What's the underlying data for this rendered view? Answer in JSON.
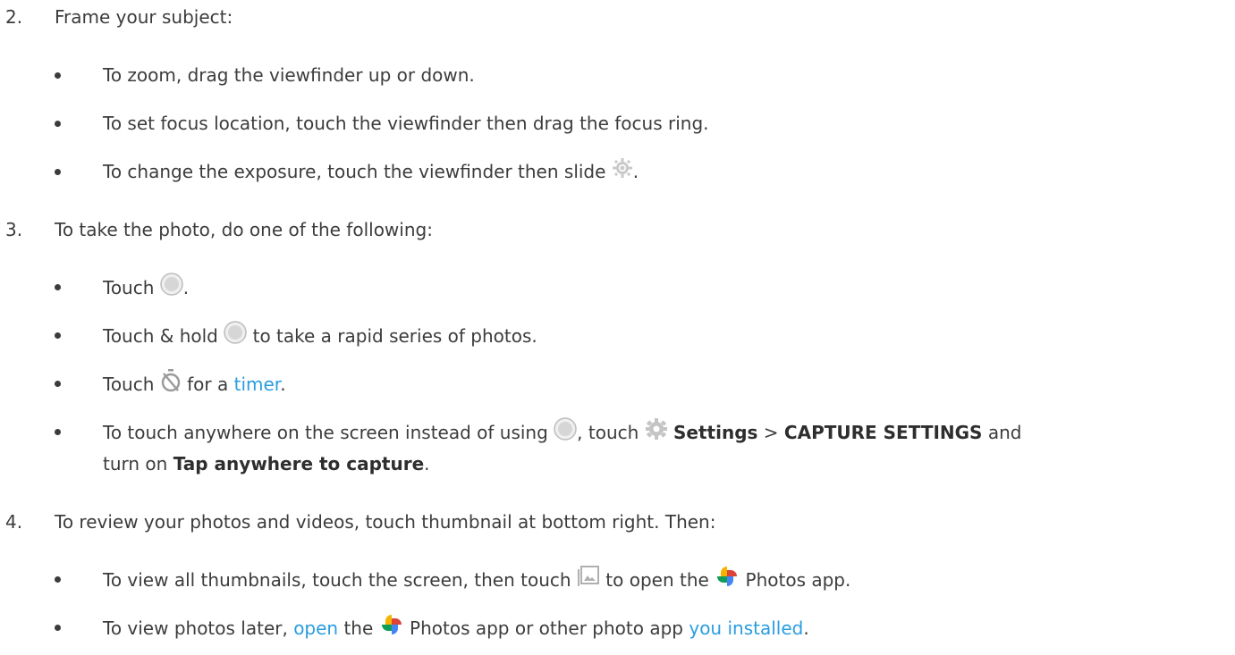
{
  "steps": [
    {
      "num": "2.",
      "text": "Frame your subject:",
      "bullets": [
        {
          "text": "To zoom, drag the viewfinder up or down."
        },
        {
          "text": "To set focus location, touch the viewfinder then drag the focus ring."
        },
        {
          "before": "To change the exposure, touch the viewfinder then slide",
          "after": "."
        }
      ]
    },
    {
      "num": "3.",
      "text": "To take the photo, do one of the following:",
      "bullets": [
        {
          "before": "Touch",
          "after": "."
        },
        {
          "before": "Touch & hold",
          "after": "to take a rapid series of photos."
        },
        {
          "before": "Touch",
          "mid": "for a",
          "link": "timer",
          "after": "."
        },
        {
          "before": "To touch anywhere on the screen instead of using",
          "mid": ", touch",
          "bold1": "Settings",
          "sep": " > ",
          "bold2": "CAPTURE SETTINGS",
          "tail": " and",
          "line2_pre": "turn on ",
          "bold3": "Tap anywhere to capture",
          "line2_post": "."
        }
      ]
    },
    {
      "num": "4.",
      "text": "To review your photos and videos, touch thumbnail at bottom right. Then:",
      "bullets": [
        {
          "before": "To view all thumbnails, touch the screen, then touch",
          "mid": "to open the",
          "after": "Photos app."
        },
        {
          "before": "To view photos later,",
          "link": "open",
          "mid": "the",
          "after": "Photos app or other photo app",
          "link2": "you installed",
          "end": "."
        }
      ]
    }
  ],
  "colors": {
    "text": "#3c3c3c",
    "link": "#2a9de0"
  },
  "icons": [
    "exposure-icon",
    "shutter-icon",
    "timer-icon",
    "settings-gear-icon",
    "gallery-icon",
    "google-photos-icon"
  ]
}
